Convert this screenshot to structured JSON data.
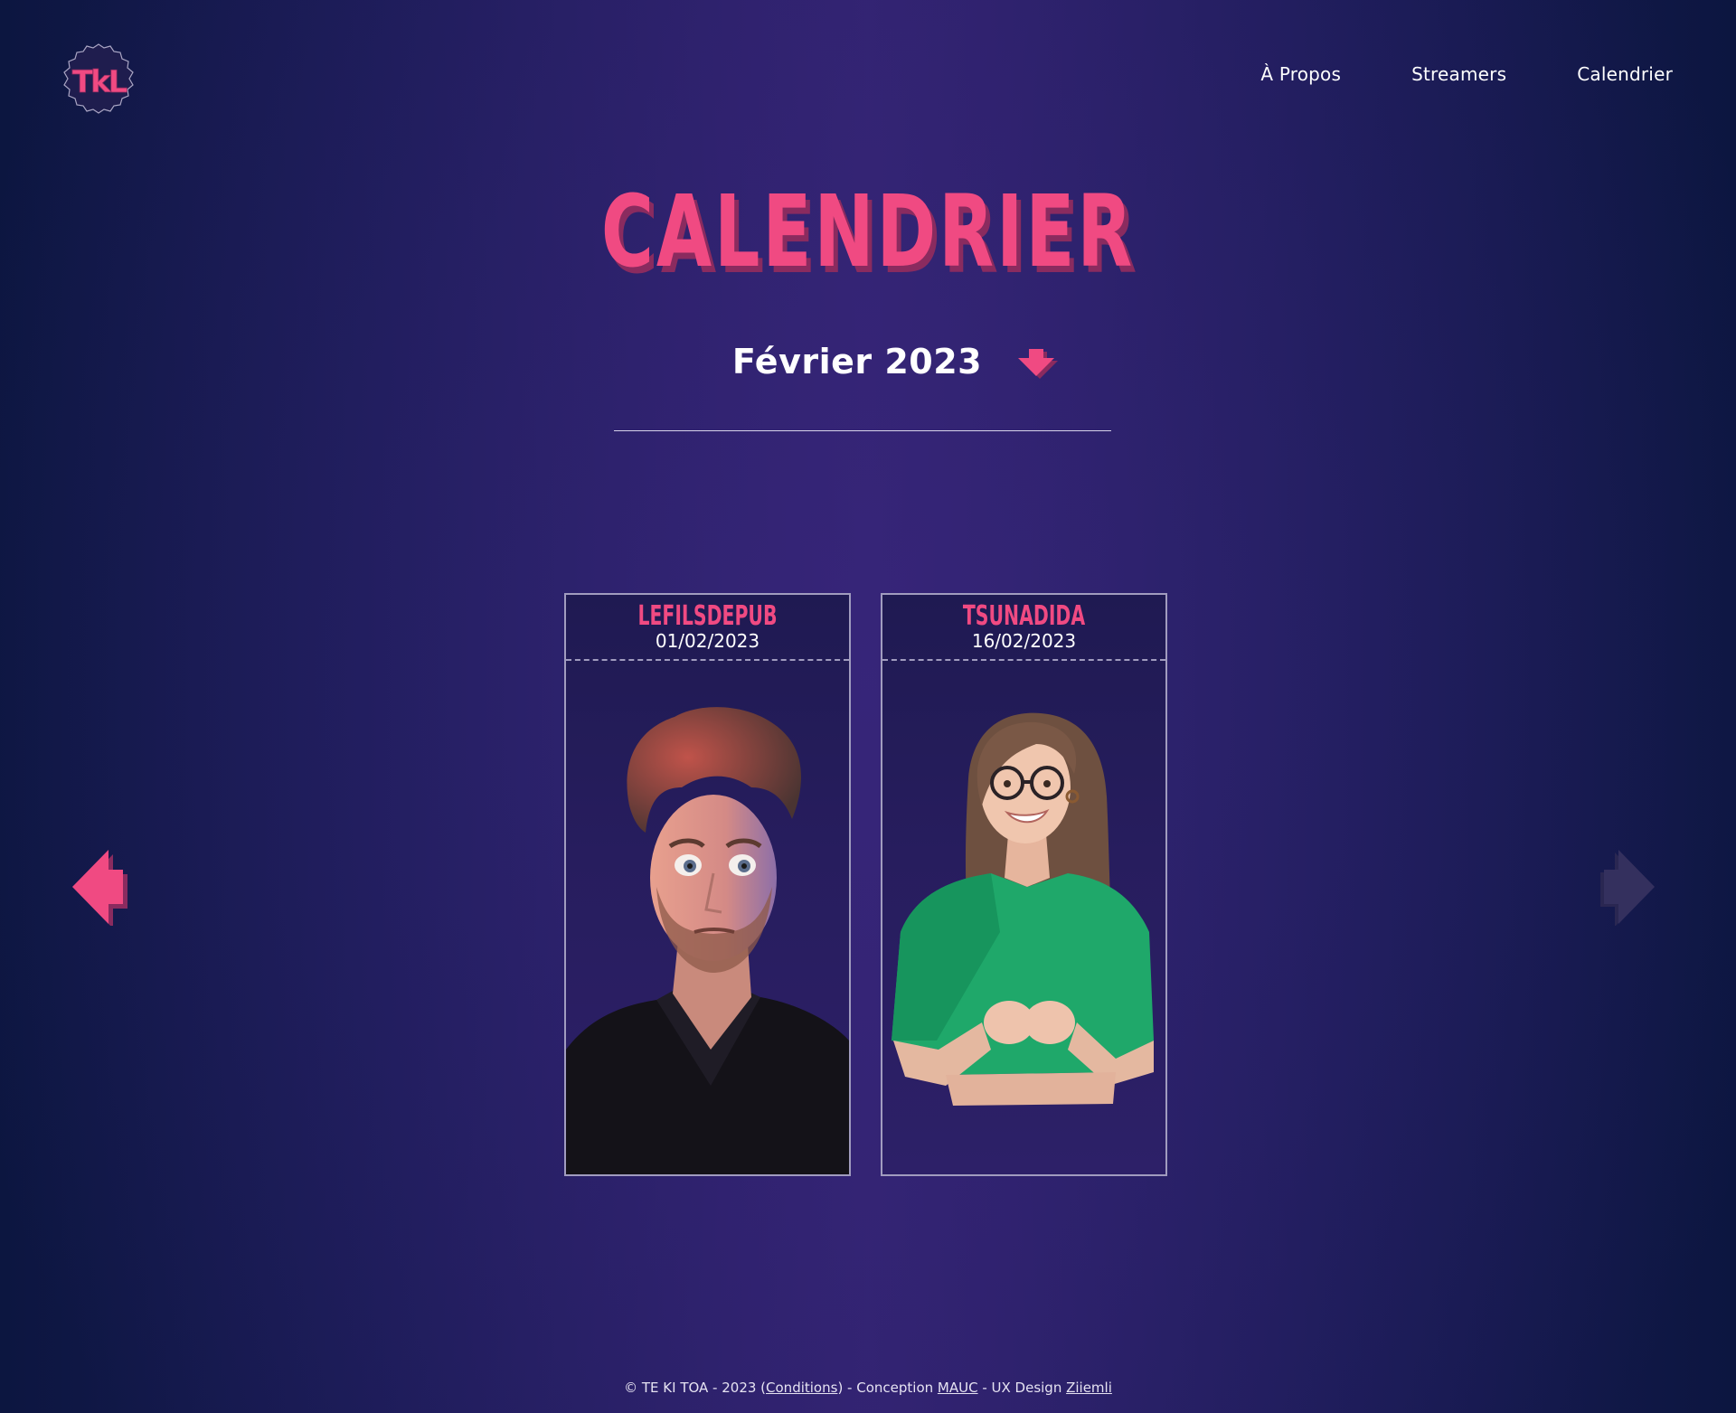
{
  "brand": {
    "logo_text": "TkL",
    "accent_color": "#f04a82"
  },
  "nav": {
    "items": [
      {
        "label": "À Propos"
      },
      {
        "label": "Streamers"
      },
      {
        "label": "Calendrier"
      }
    ]
  },
  "page": {
    "title": "Calendrier",
    "month": "Février 2023"
  },
  "cards": [
    {
      "name": "LeFilsDepub",
      "date": "01/02/2023"
    },
    {
      "name": "Tsunadida",
      "date": "16/02/2023"
    }
  ],
  "footer": {
    "prefix": "© TE KI TOA - 2023 (",
    "conditions": "Conditions",
    "mid1": ") - Conception ",
    "conception": "MAUC",
    "mid2": " - UX Design ",
    "ux": "Ziiemli"
  },
  "icons": {
    "logo": "tkl-logo-icon",
    "month_toggle": "chevron-down-icon",
    "prev": "arrow-left-icon",
    "next": "arrow-right-icon"
  },
  "colors": {
    "accent": "#f04a82",
    "accent_shadow": "#8a2b5f",
    "arrow_disabled": "#34305e",
    "background": "#1c1b58"
  }
}
